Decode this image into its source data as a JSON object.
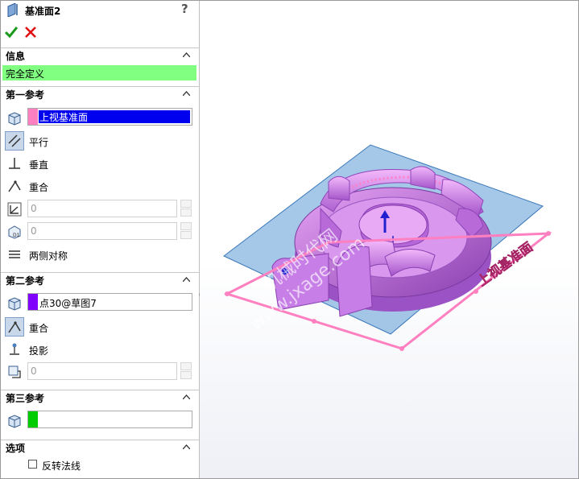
{
  "feature": {
    "title": "基准面2",
    "icon": "datum-plane-icon",
    "help": "?"
  },
  "actions": {
    "ok_icon": "checkmark-icon",
    "cancel_icon": "close-icon"
  },
  "info_section": {
    "title": "信息",
    "status": "完全定义",
    "status_color": "#80ff80"
  },
  "first_reference": {
    "title": "第一参考",
    "selection": "上视基准面",
    "swatch_color": "#ff80c0",
    "constraints": [
      {
        "label": "平行",
        "icon": "parallel-icon",
        "selected": true
      },
      {
        "label": "垂直",
        "icon": "perpendicular-icon",
        "selected": false
      },
      {
        "label": "重合",
        "icon": "coincident-icon",
        "selected": false
      }
    ],
    "angle_value": "0",
    "distance_value": "0",
    "symmetric_label": "两侧对称"
  },
  "second_reference": {
    "title": "第二参考",
    "selection": "点30@草图7",
    "swatch_color": "#8000ff",
    "constraints": [
      {
        "label": "重合",
        "icon": "coincident-icon",
        "selected": true
      },
      {
        "label": "投影",
        "icon": "project-icon",
        "selected": false
      }
    ],
    "distance_value": "0"
  },
  "third_reference": {
    "title": "第三参考",
    "selection": "",
    "swatch_color": "#00cc00"
  },
  "options": {
    "title": "选项",
    "flip_normal_label": "反转法线",
    "flip_normal_checked": false
  },
  "viewport": {
    "plane_label": "上视基准面",
    "watermark_lines": [
      "机械时代网",
      "www.jxage.com"
    ],
    "plane_color": "#5b9bd5",
    "preview_color": "#ff80c0",
    "part_color": "#c878e8"
  }
}
